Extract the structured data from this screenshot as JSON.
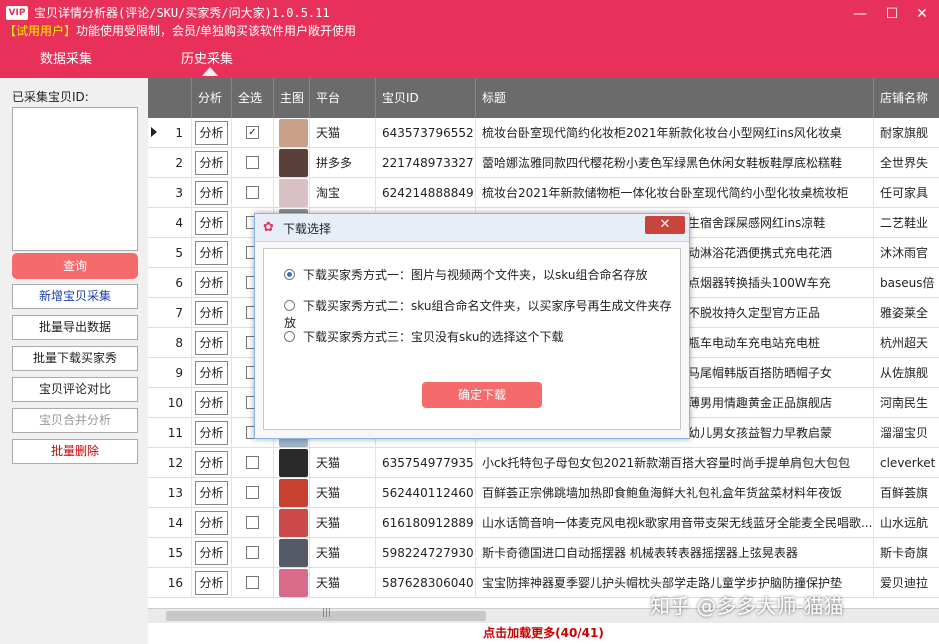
{
  "window": {
    "vip_badge": "VIP",
    "title": "宝贝详情分析器(评论/SKU/买家秀/问大家)1.0.5.11",
    "trial_prefix": "【试用用户】",
    "trial_text": "功能使用受限制，会员/单独购买该软件用户敞开使用",
    "minimize": "—",
    "maximize": "☐",
    "close": "✕"
  },
  "nav": {
    "tabs": [
      "数据采集",
      "历史采集"
    ],
    "active": "历史采集"
  },
  "sidebar": {
    "collect_label": "已采集宝贝ID:",
    "query": "查询",
    "buttons": [
      "新增宝贝采集",
      "批量导出数据",
      "批量下载买家秀",
      "宝贝评论对比",
      "宝贝合并分析",
      "批量删除"
    ]
  },
  "table": {
    "headers": [
      "",
      "分析",
      "全选",
      "主图",
      "平台",
      "宝贝ID",
      "标题",
      "店铺名称"
    ],
    "analyze_label": "分析",
    "rows": [
      {
        "n": "1",
        "platform": "天猫",
        "id": "643573796552",
        "title": "梳妆台卧室现代简约化妆柜2021年新款化妆台小型网红ins风化妆桌",
        "shop": "耐家旗舰",
        "checked": true,
        "thumb": "#c9a08a"
      },
      {
        "n": "2",
        "platform": "拼多多",
        "id": "221748973327",
        "title": "蕾哈娜汯雅同款四代樱花粉小麦色军绿黑色休闲女鞋板鞋厚底松糕鞋",
        "shop": "全世界失",
        "checked": false,
        "thumb": "#5a4038"
      },
      {
        "n": "3",
        "platform": "淘宝",
        "id": "624214888849",
        "title": "梳妆台2021年新款储物柜一体化妆台卧室现代简约小型化妆桌梳妆柜",
        "shop": "任可家具",
        "checked": false,
        "thumb": "#d9c0c4"
      },
      {
        "n": "4",
        "platform": "",
        "id": "",
        "title": "生宿舍踩屎感网红ins凉鞋",
        "shop": "二艺鞋业",
        "checked": false,
        "thumb": "#8a8f9a"
      },
      {
        "n": "5",
        "platform": "",
        "id": "",
        "title": "动淋浴花洒便携式充电花洒",
        "shop": "沐沐雨官",
        "checked": false,
        "thumb": "#7aa4c8"
      },
      {
        "n": "6",
        "platform": "",
        "id": "",
        "title": "点烟器转换插头100W车充",
        "shop": "baseus倍",
        "checked": false,
        "thumb": "#444"
      },
      {
        "n": "7",
        "platform": "",
        "id": "",
        "title": "不脱妆持久定型官方正品",
        "shop": "雅姿莱全",
        "checked": false,
        "thumb": "#e6c7b0"
      },
      {
        "n": "8",
        "platform": "",
        "id": "",
        "title": "瓶车电动车充电站充电桩",
        "shop": "杭州超天",
        "checked": false,
        "thumb": "#6a88b0"
      },
      {
        "n": "9",
        "platform": "",
        "id": "",
        "title": "马尾帽韩版百搭防晒帽子女",
        "shop": "从佐旗舰",
        "checked": false,
        "thumb": "#b89c7e"
      },
      {
        "n": "10",
        "platform": "",
        "id": "",
        "title": "薄男用情趣黄金正品旗舰店",
        "shop": "河南民生",
        "checked": false,
        "thumb": "#3c4a78"
      },
      {
        "n": "11",
        "platform": "",
        "id": "",
        "title": "幼儿男女孩益智力早教启蒙",
        "shop": "溜溜宝贝",
        "checked": false,
        "thumb": "#9fb3c2"
      },
      {
        "n": "12",
        "platform": "天猫",
        "id": "635754977935",
        "title": "小ck托特包子母包女包2021新款潮百搭大容量时尚手提单肩包大包包",
        "shop": "cleverket",
        "checked": false,
        "thumb": "#2a2a2a"
      },
      {
        "n": "13",
        "platform": "天猫",
        "id": "562440112460",
        "title": "百鲜荟正宗佛跳墙加热即食鲍鱼海鲜大礼包礼盒年货盆菜材料年夜饭",
        "shop": "百鲜荟旗",
        "checked": false,
        "thumb": "#c84030"
      },
      {
        "n": "14",
        "platform": "天猫",
        "id": "616180912889",
        "title": "山水话筒音响一体麦克风电视k歌家用音带支架无线蓝牙全能麦全民唱歌...",
        "shop": "山水远航",
        "checked": false,
        "thumb": "#cc4a4a"
      },
      {
        "n": "15",
        "platform": "天猫",
        "id": "598224727930",
        "title": "斯卡奇德国进口自动摇摆器 机械表转表器摇摆器上弦晃表器",
        "shop": "斯卡奇旗",
        "checked": false,
        "thumb": "#555a66"
      },
      {
        "n": "16",
        "platform": "天猫",
        "id": "587628306040",
        "title": "宝宝防摔神器夏季婴儿护头帽枕头部学走路儿童学步护脑防撞保护垫",
        "shop": "爱贝迪拉",
        "checked": false,
        "thumb": "#d86a8a"
      }
    ]
  },
  "scroll_grip": "|||",
  "load_more": "点击加载更多(40/41)",
  "watermark": "知乎 @多多大师-猫猫",
  "dialog": {
    "icon": "✿",
    "title": "下载选择",
    "close": "✕",
    "options": [
      "下载买家秀方式一：图片与视频两个文件夹，以sku组合命名存放",
      "下载买家秀方式二：sku组合命名文件夹，以买家序号再生成文件夹存放",
      "下载买家秀方式三：宝贝没有sku的选择这个下载"
    ],
    "selected": 0,
    "confirm": "确定下载"
  },
  "colors": {
    "brand": "#e8315a",
    "button": "#f56b6b",
    "header": "#6b6b6b"
  }
}
